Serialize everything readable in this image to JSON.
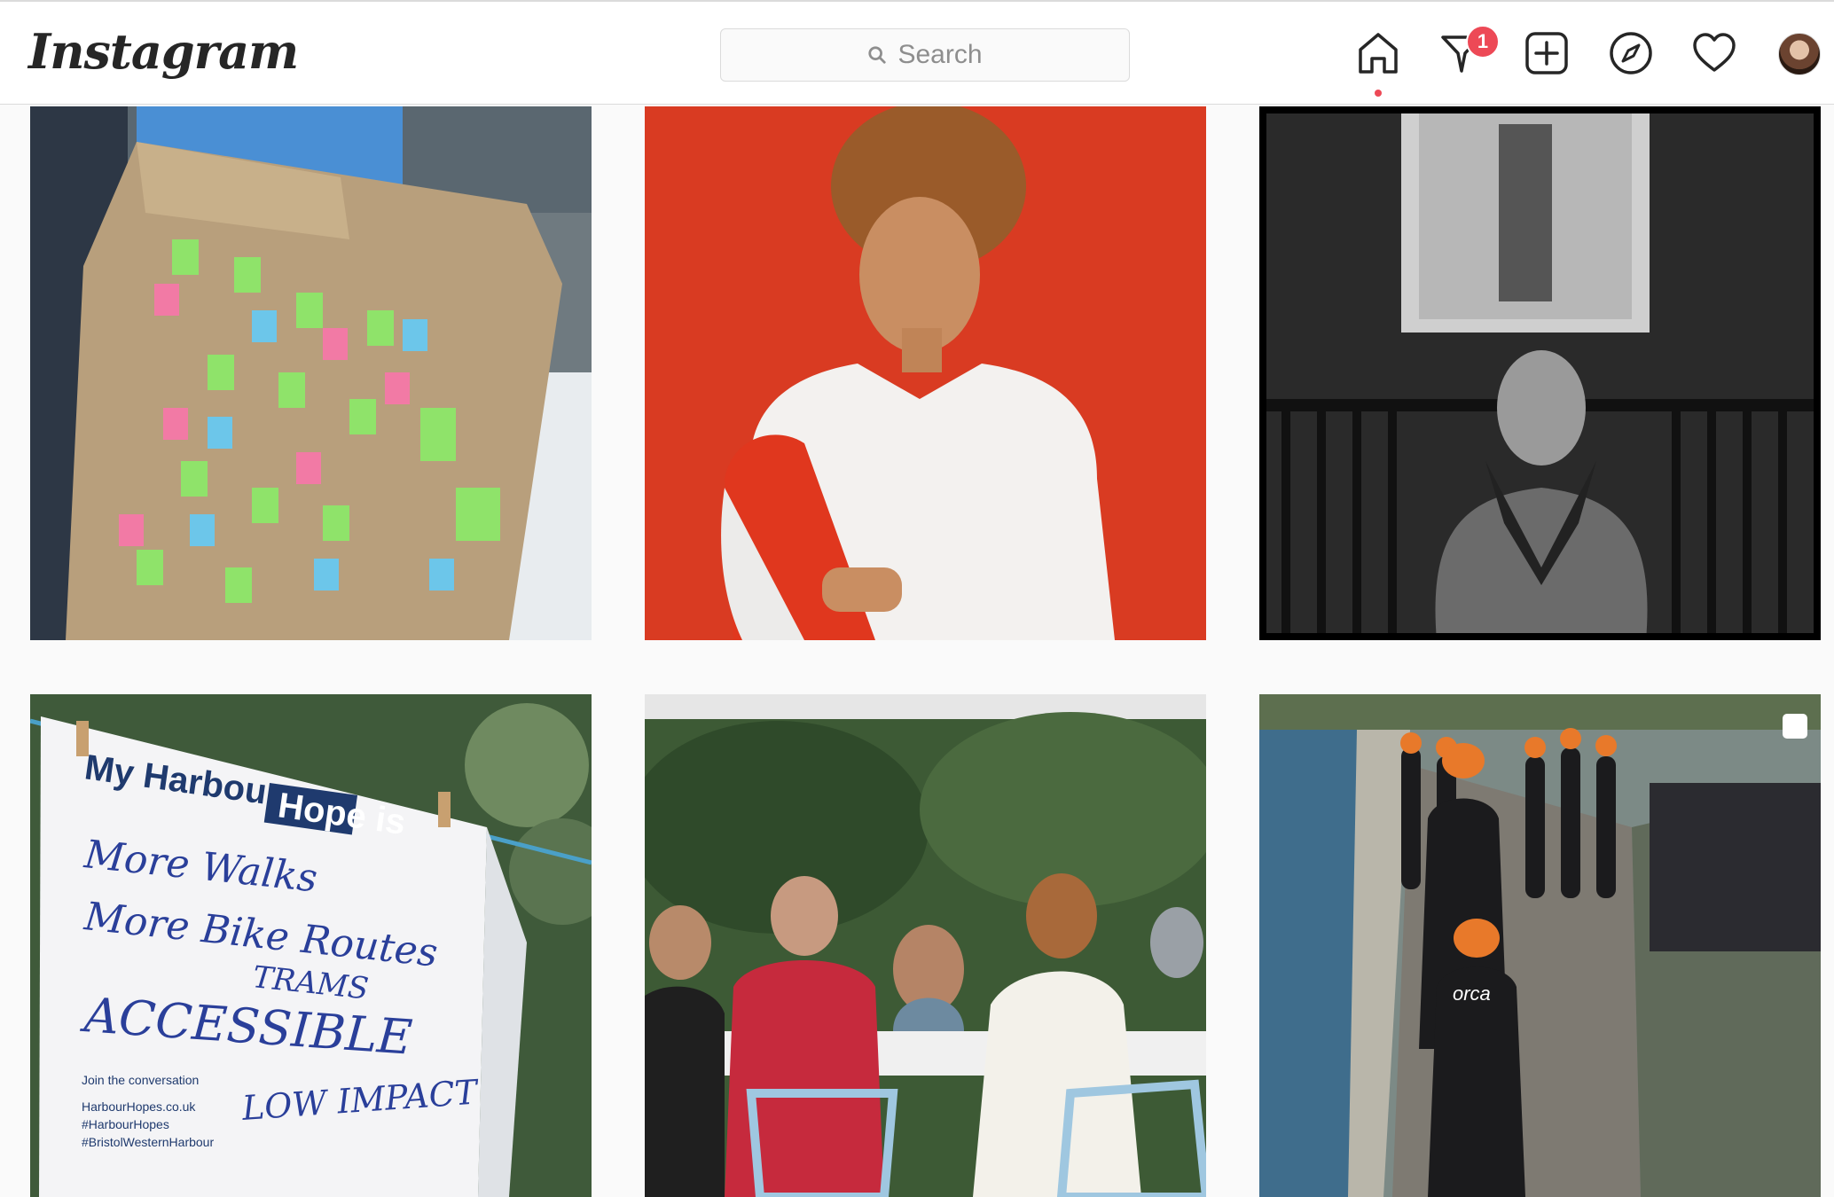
{
  "app": {
    "logo_text": "Instagram"
  },
  "search": {
    "placeholder": "Search"
  },
  "nav": {
    "icons": [
      "home-icon",
      "direct-messages-icon",
      "new-post-icon",
      "explore-icon",
      "activity-heart-icon",
      "profile-avatar"
    ],
    "messages_badge_count": "1"
  },
  "post_images": {
    "sign_title_line1": "My Harbour",
    "sign_title_line2": "Hope is",
    "sign_line1": "More   Walks",
    "sign_line2": "More   Bike Routes",
    "sign_line3": "TRAMS",
    "sign_line4": "ACCESSIBLE",
    "sign_line5": "LOW IMPACT",
    "sign_join": "Join the conversation",
    "sign_url": "HarbourHopes.co.uk",
    "sign_tag1": "#HarbourHopes",
    "sign_tag2": "#BristolWesternHarbour",
    "wetsuit_brand": "orca"
  },
  "colors": {
    "badge": "#ed4956",
    "border": "#dbdbdb",
    "background": "#fafafa"
  }
}
